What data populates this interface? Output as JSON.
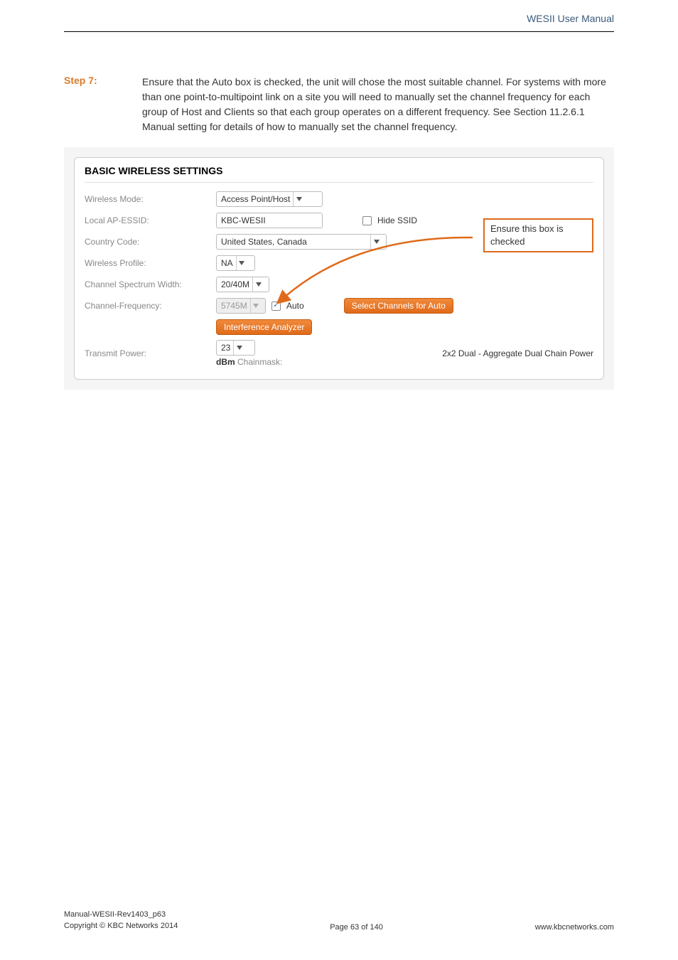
{
  "header": {
    "title": "WESII User Manual"
  },
  "step": {
    "label": "Step 7:",
    "text": "Ensure that the Auto box is checked, the unit will chose the most suitable channel. For systems with more than one point-to-multipoint link on a site you will need to manually set the channel frequency for each group of Host and Clients so that each group operates on a different frequency. See Section 11.2.6.1 Manual setting for details of how to manually set the channel frequency."
  },
  "panel": {
    "title": "BASIC WIRELESS SETTINGS",
    "rows": {
      "wireless_mode": {
        "label": "Wireless Mode:",
        "value": "Access Point/Host"
      },
      "local_essid": {
        "label": "Local AP-ESSID:",
        "value": "KBC-WESII",
        "hide_ssid_label": "Hide SSID"
      },
      "country_code": {
        "label": "Country Code:",
        "value": "United States, Canada"
      },
      "wireless_profile": {
        "label": "Wireless Profile:",
        "value": "NA"
      },
      "spectrum_width": {
        "label": "Channel Spectrum Width:",
        "value": "20/40M"
      },
      "channel_freq": {
        "label": "Channel-Frequency:",
        "value": "5745M",
        "auto_label": "Auto",
        "select_btn": "Select Channels for Auto"
      },
      "interference_btn": "Interference Analyzer",
      "transmit_power": {
        "label": "Transmit Power:",
        "value": "23",
        "chainmask_label_bold": "dBm",
        "chainmask_label_rest": " Chainmask:",
        "note": "2x2 Dual - Aggregate Dual Chain Power"
      }
    }
  },
  "callout": {
    "text": "Ensure this box is checked"
  },
  "footer": {
    "line1": "Manual-WESII-Rev1403_p63",
    "line2": "Copyright © KBC Networks 2014",
    "center": "Page 63 of 140",
    "right": "www.kbcnetworks.com"
  }
}
